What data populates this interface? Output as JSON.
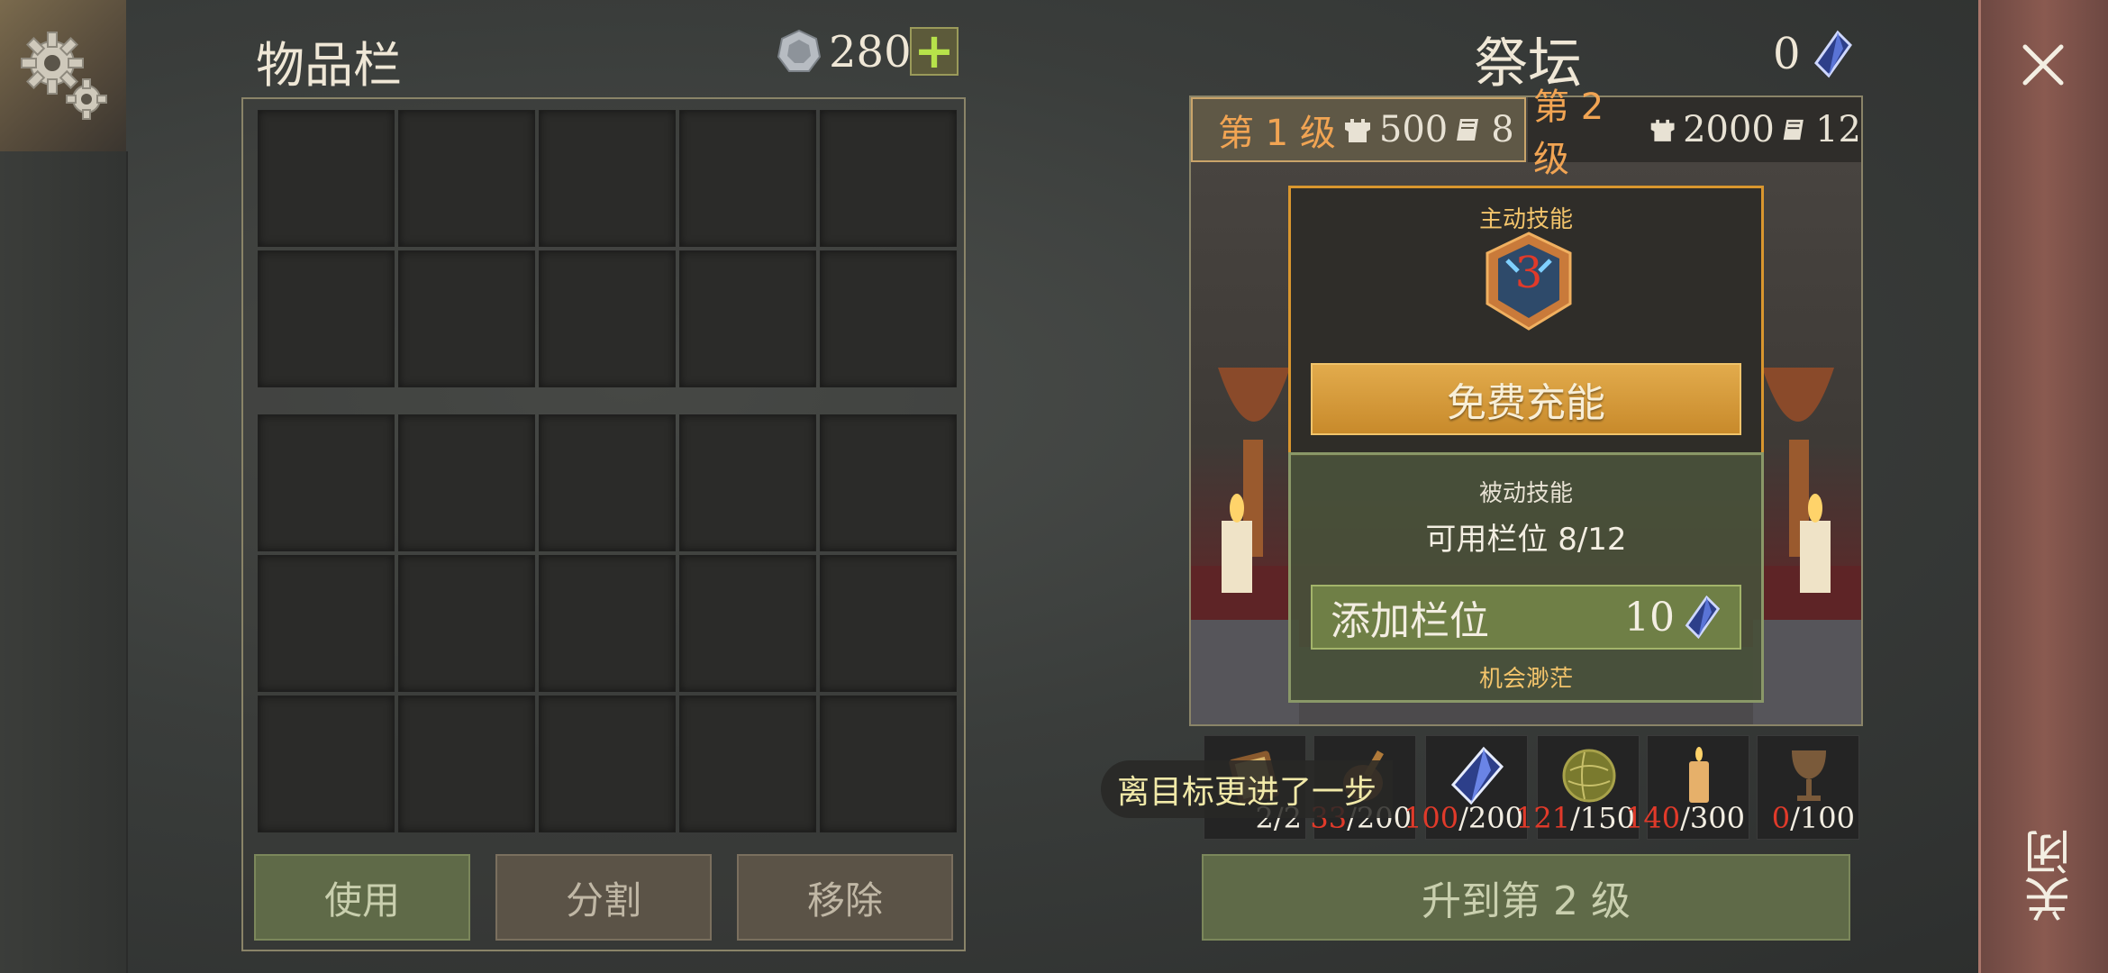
{
  "inventory": {
    "title": "物品栏",
    "coins": "280",
    "add_symbol": "+",
    "buttons": {
      "use": "使用",
      "split": "分割",
      "remove": "移除"
    }
  },
  "altar": {
    "title": "祭坛",
    "crystals": "0",
    "tabs": [
      {
        "label": "第 1 级",
        "towers": "500",
        "books": "8"
      },
      {
        "label": "第 2 级",
        "towers": "2000",
        "books": "12"
      }
    ],
    "active": {
      "label": "主动技能",
      "shield_number": "3",
      "charge_button": "免费充能"
    },
    "passive": {
      "label": "被动技能",
      "slots_available": "可用栏位 8/12",
      "add_slot_label": "添加栏位",
      "add_slot_cost": "10",
      "chance_label": "机会渺茫"
    },
    "materials": [
      {
        "icon": "book-icon",
        "have": "2",
        "need": "/2"
      },
      {
        "icon": "bag-icon",
        "have": "33",
        "need": "/200"
      },
      {
        "icon": "crystal-icon",
        "have": "100",
        "need": "/200"
      },
      {
        "icon": "ball-icon",
        "have": "121",
        "need": "/150"
      },
      {
        "icon": "candle-icon",
        "have": "140",
        "need": "/300"
      },
      {
        "icon": "goblet-icon",
        "have": "0",
        "need": "/100"
      }
    ],
    "toast": "离目标更进了一步",
    "upgrade_button": "升到第 2 级"
  },
  "close_label": "关闭",
  "colors": {
    "accent_orange": "#f1a453",
    "deficit_red": "#e03a2a",
    "confirm_green": "#6f7f46"
  }
}
